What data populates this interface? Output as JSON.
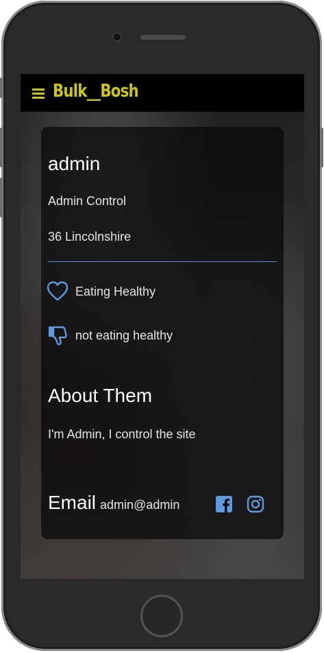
{
  "navbar": {
    "brand": "Bulk__Bosh",
    "menu_icon": "hamburger-icon",
    "accent_color": "#c9c616"
  },
  "profile": {
    "username": "admin",
    "role": "Admin Control",
    "address": "36 Lincolnshire",
    "likes": [
      {
        "icon": "heart-icon",
        "label": "Eating Healthy"
      },
      {
        "icon": "thumbs-down-icon",
        "label": "not eating healthy"
      }
    ],
    "about_title": "About Them",
    "about_text": "I'm Admin, I control the site",
    "email_label": "Email",
    "email_value": "admin@admin",
    "social": [
      {
        "icon": "facebook-icon"
      },
      {
        "icon": "instagram-icon"
      }
    ],
    "accent_color": "#5e9be0"
  }
}
